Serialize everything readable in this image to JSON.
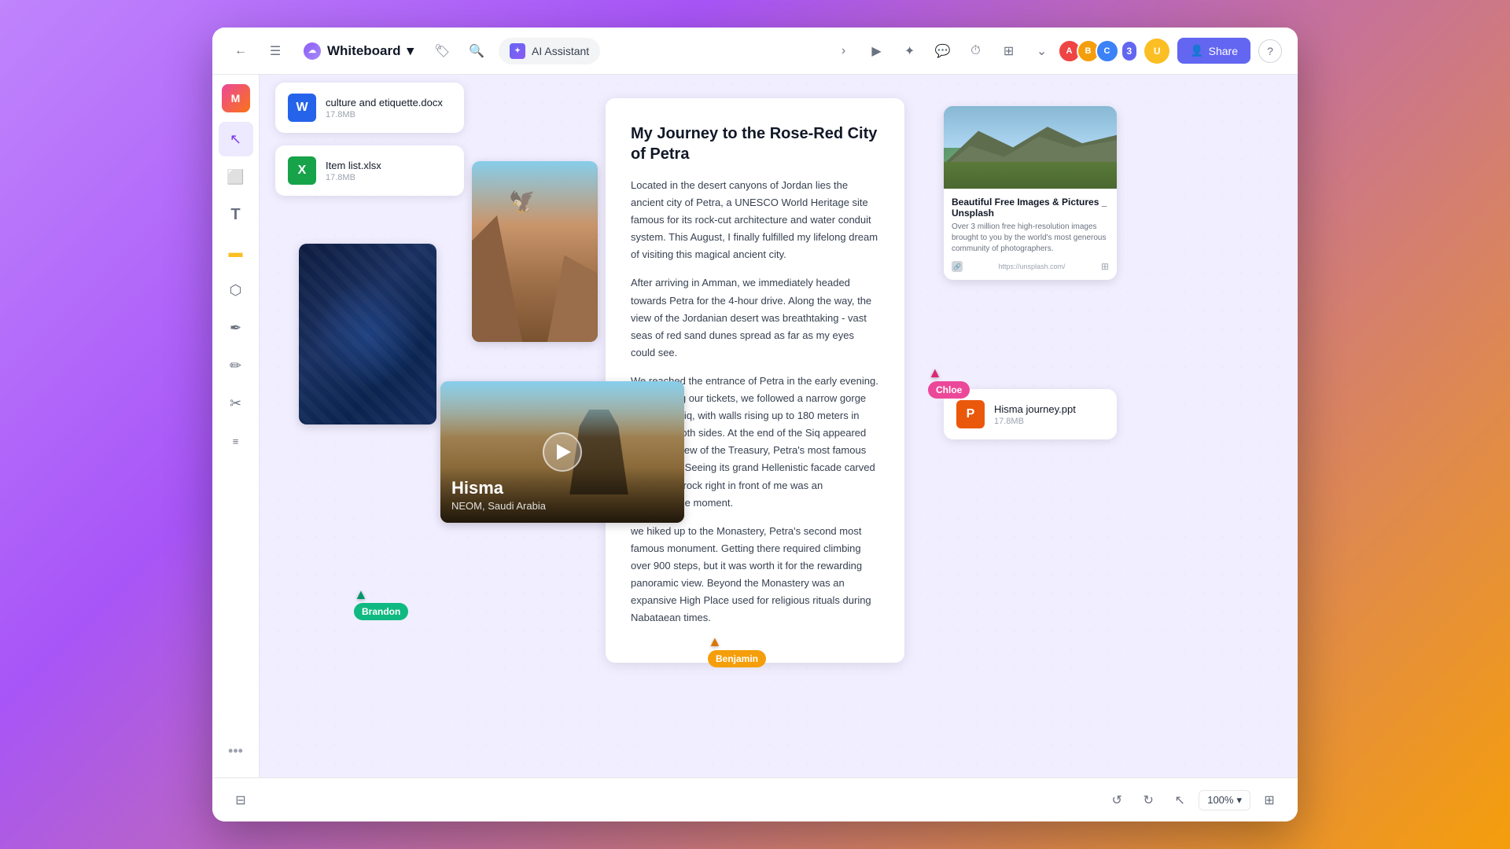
{
  "app": {
    "title": "Whiteboard",
    "cloud_label": "☁",
    "dropdown_arrow": "▾"
  },
  "topbar": {
    "back_label": "←",
    "menu_label": "☰",
    "tag_label": "🏷",
    "search_label": "🔍",
    "ai_assistant_label": "AI Assistant",
    "play_label": "▶",
    "star_label": "✦",
    "chat_label": "💬",
    "timer_label": "⏱",
    "table_label": "⊞",
    "more_label": "⋯",
    "share_label": "Share",
    "help_label": "?",
    "avatar_count": "3"
  },
  "sidebar": {
    "tools": [
      {
        "name": "select-tool",
        "icon": "↖",
        "label": "Select"
      },
      {
        "name": "frame-tool",
        "icon": "⬜",
        "label": "Frame"
      },
      {
        "name": "text-tool",
        "icon": "T",
        "label": "Text"
      },
      {
        "name": "sticky-tool",
        "icon": "🟨",
        "label": "Sticky Note"
      },
      {
        "name": "shape-tool",
        "icon": "⬡",
        "label": "Shape"
      },
      {
        "name": "pen-tool",
        "icon": "✒",
        "label": "Pen"
      },
      {
        "name": "brush-tool",
        "icon": "✏",
        "label": "Brush"
      },
      {
        "name": "scissors-tool",
        "icon": "✂",
        "label": "Scissors"
      },
      {
        "name": "list-tool",
        "icon": "☰",
        "label": "List"
      }
    ],
    "more_label": "•••"
  },
  "files": {
    "word_file": {
      "name": "culture and etiquette.docx",
      "size": "17.8MB",
      "icon": "W",
      "type": "word"
    },
    "excel_file": {
      "name": "Item list.xlsx",
      "size": "17.8MB",
      "icon": "X",
      "type": "excel"
    },
    "ppt_file": {
      "name": "Hisma journey.ppt",
      "size": "17.8MB",
      "icon": "P",
      "type": "ppt"
    }
  },
  "article": {
    "title": "My Journey to the Rose-Red City of Petra",
    "body1": "Located in the desert canyons of Jordan lies the ancient city of Petra, a UNESCO World Heritage site famous for its rock-cut architecture and water conduit system. This August, I finally fulfilled my lifelong dream of visiting this magical ancient city.",
    "body2": "After arriving in Amman, we immediately headed towards Petra for the 4-hour drive. Along the way, the view of the Jordanian desert was breathtaking - vast seas of red sand dunes spread as far as my eyes could see.",
    "body3": "We reached the entrance of Petra in the early evening. After getting our tickets, we followed a narrow gorge called the Siq, with walls rising up to 180 meters in height on both sides. At the end of the Siq appeared the iconic view of the Treasury, Petra's most famous monument. Seeing its grand Hellenistic facade carved out of solid rock right in front of me was an unforgettable moment.",
    "body4": "we hiked up to the Monastery, Petra's second most famous monument. Getting there required climbing over 900 steps, but it was worth it for the rewarding panoramic view. Beyond the Monastery was an expansive High Place used for religious rituals during Nabataean times."
  },
  "link_preview": {
    "title": "Beautiful Free Images & Pictures _ Unsplash",
    "description": "Over 3 million free high-resolution images brought to you by the world's most generous community of photographers.",
    "url": "https://unsplash.com/"
  },
  "video": {
    "location_title": "Hisma",
    "location_subtitle": "NEOM, Saudi Arabia"
  },
  "cursors": {
    "brandon": {
      "name": "Brandon",
      "color": "#10b981",
      "arrow_color": "#059669"
    },
    "benjamin": {
      "name": "Benjamin",
      "color": "#f59e0b",
      "arrow_color": "#d97706"
    },
    "chloe": {
      "name": "Chloe",
      "color": "#ec4899",
      "arrow_color": "#db2777"
    }
  },
  "bottombar": {
    "undo_label": "↺",
    "redo_label": "↻",
    "cursor_label": "↖",
    "zoom_label": "100%",
    "map_label": "⊞"
  }
}
